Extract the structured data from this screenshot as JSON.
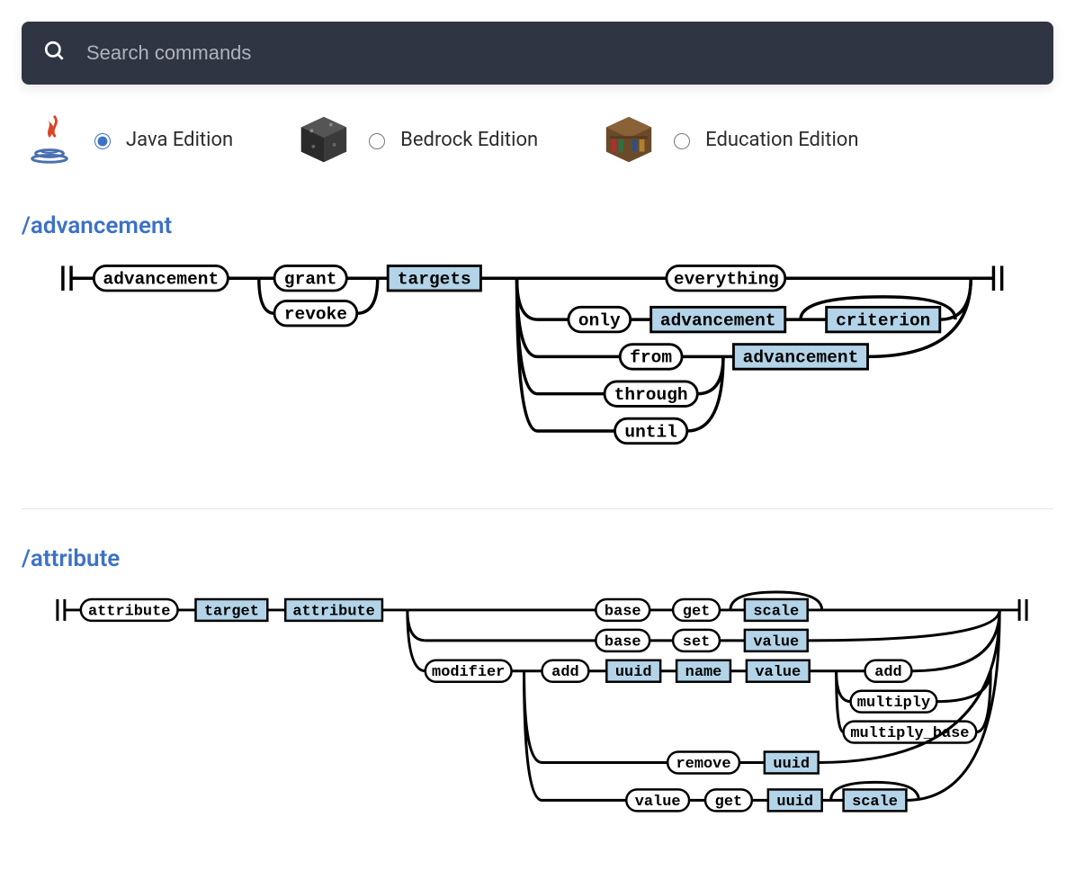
{
  "search": {
    "placeholder": "Search commands"
  },
  "editions": {
    "java": {
      "label": "Java Edition",
      "selected": true
    },
    "bedrock": {
      "label": "Bedrock Edition",
      "selected": false
    },
    "education": {
      "label": "Education Edition",
      "selected": false
    }
  },
  "commands": [
    {
      "name": "/advancement",
      "syntax": {
        "root": "advancement",
        "operations": [
          "grant",
          "revoke"
        ],
        "target_arg": "targets",
        "branches": [
          {
            "keyword": "everything"
          },
          {
            "keyword": "only",
            "args": [
              "advancement",
              "criterion"
            ]
          },
          {
            "keyword": "from",
            "args": [
              "advancement"
            ]
          },
          {
            "keyword": "through",
            "args": [
              "advancement"
            ]
          },
          {
            "keyword": "until",
            "args": [
              "advancement"
            ]
          }
        ]
      }
    },
    {
      "name": "/attribute",
      "syntax": {
        "root": "attribute",
        "args_head": [
          "target",
          "attribute"
        ],
        "branches": [
          {
            "path": [
              {
                "lit": "base"
              },
              {
                "lit": "get"
              },
              {
                "arg": "scale",
                "optional": true
              }
            ]
          },
          {
            "path": [
              {
                "lit": "base"
              },
              {
                "lit": "set"
              },
              {
                "arg": "value"
              }
            ]
          },
          {
            "path": [
              {
                "lit": "modifier"
              },
              {
                "lit": "add"
              },
              {
                "arg": "uuid"
              },
              {
                "arg": "name"
              },
              {
                "arg": "value"
              }
            ],
            "tail_branches": [
              "add",
              "multiply",
              "multiply_base"
            ]
          },
          {
            "path": [
              {
                "lit": "modifier"
              },
              {
                "lit": "remove"
              },
              {
                "arg": "uuid"
              }
            ]
          },
          {
            "path": [
              {
                "lit": "modifier"
              },
              {
                "lit": "value"
              },
              {
                "lit": "get"
              },
              {
                "arg": "uuid"
              },
              {
                "arg": "scale",
                "optional": true
              }
            ]
          }
        ]
      }
    }
  ],
  "labels": {
    "adv": {
      "root": "advancement",
      "grant": "grant",
      "revoke": "revoke",
      "targets": "targets",
      "everything": "everything",
      "only": "only",
      "from": "from",
      "through": "through",
      "until": "until",
      "advancement_arg": "advancement",
      "criterion": "criterion"
    },
    "attr": {
      "root": "attribute",
      "target": "target",
      "attribute": "attribute",
      "base": "base",
      "get": "get",
      "set": "set",
      "scale": "scale",
      "value": "value",
      "modifier": "modifier",
      "add": "add",
      "uuid": "uuid",
      "name": "name",
      "remove": "remove",
      "multiply": "multiply",
      "multiply_base": "multiply_base"
    }
  }
}
